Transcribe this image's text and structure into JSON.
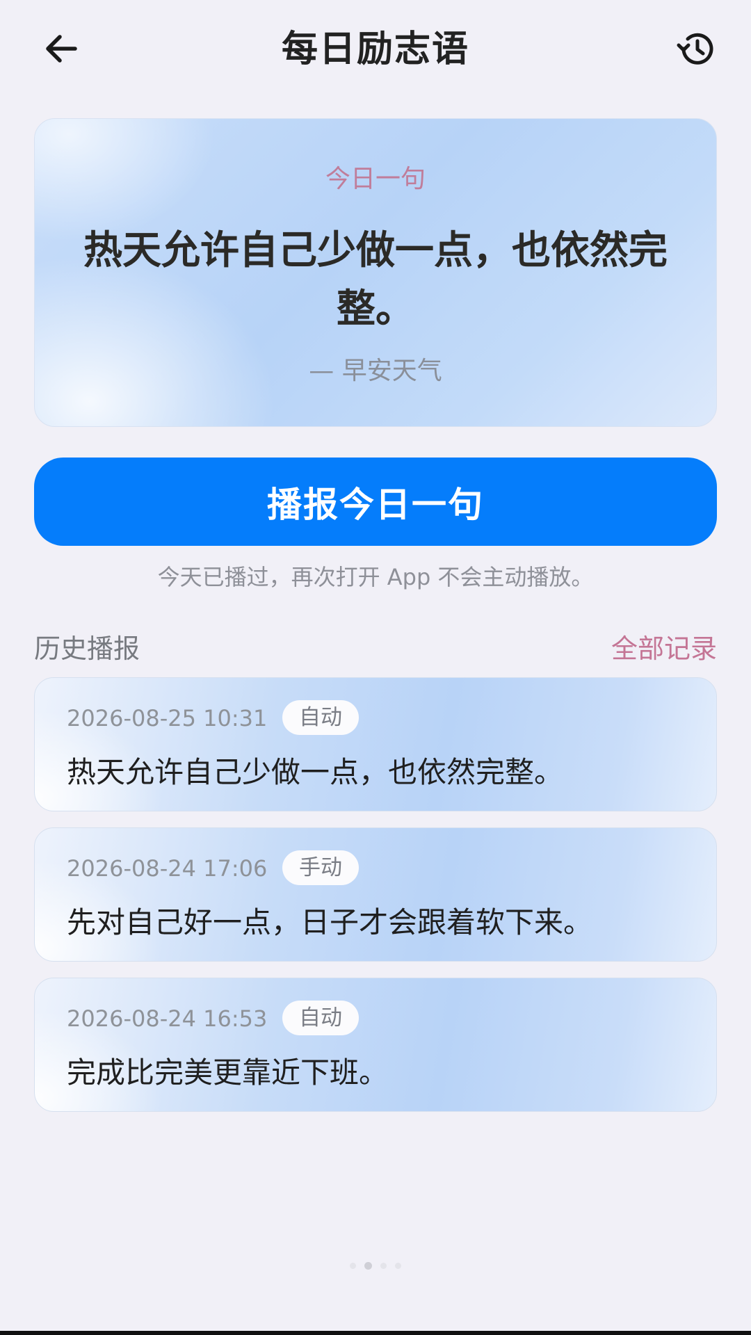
{
  "header": {
    "title": "每日励志语",
    "back_icon": "arrow-left-icon",
    "history_icon": "history-clock-icon"
  },
  "today": {
    "label": "今日一句",
    "quote": "热天允许自己少做一点，也依然完整。",
    "author": "— 早安天气"
  },
  "play_button": {
    "label": "播报今日一句"
  },
  "play_note": "今天已播过，再次打开 App 不会主动播放。",
  "history": {
    "title": "历史播报",
    "all_link": "全部记录",
    "items": [
      {
        "time": "2026-08-25 10:31",
        "tag": "自动",
        "text": "热天允许自己少做一点，也依然完整。"
      },
      {
        "time": "2026-08-24 17:06",
        "tag": "手动",
        "text": "先对自己好一点，日子才会跟着软下来。"
      },
      {
        "time": "2026-08-24 16:53",
        "tag": "自动",
        "text": "完成比完美更靠近下班。"
      }
    ]
  },
  "pager": {
    "count": 4,
    "active_index": 1
  },
  "colors": {
    "accent_blue": "#057dfb",
    "pink_label": "#c07d9a",
    "background": "#f1f0f7"
  }
}
